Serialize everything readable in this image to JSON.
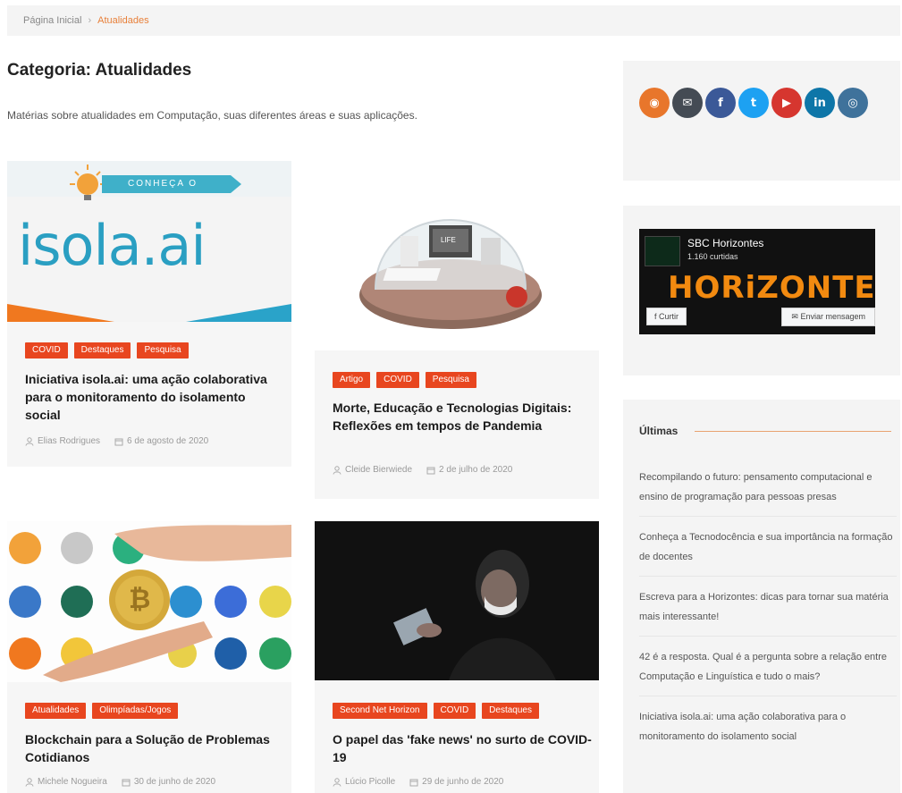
{
  "breadcrumb": {
    "home": "Página Inicial",
    "separator": "›",
    "current": "Atualidades"
  },
  "page": {
    "title": "Categoria: Atualidades",
    "description": "Matérias sobre atualidades em Computação, suas diferentes áreas e suas aplicações."
  },
  "posts": [
    {
      "tags": [
        "COVID",
        "Destaques",
        "Pesquisa"
      ],
      "title": "Iniciativa isola.ai: uma ação colaborativa para o monitoramento do isolamento social",
      "author": "Elias Rodrigues",
      "date": "6 de agosto de 2020",
      "thumb": {
        "banner": "CONHEÇA O",
        "logo": "isola.ai"
      }
    },
    {
      "tags": [
        "Artigo",
        "COVID",
        "Pesquisa"
      ],
      "title": "Morte, Educação e Tecnologias Digitais: Reflexões em tempos de Pandemia",
      "author": "Cleide Bierwiede",
      "date": "2 de julho de 2020",
      "thumb": {
        "screen": "LIFE"
      }
    },
    {
      "tags": [
        "Atualidades",
        "Olimpíadas/Jogos"
      ],
      "title": "Blockchain para a Solução de Problemas Cotidianos",
      "author": "Michele Nogueira",
      "date": "30 de junho de 2020"
    },
    {
      "tags": [
        "Second Net Horizon",
        "COVID",
        "Destaques"
      ],
      "title": "O papel das 'fake news' no surto de COVID-19",
      "author": "Lúcio Picolle",
      "date": "29 de junho de 2020"
    }
  ],
  "social": [
    {
      "name": "rss",
      "glyph": "◉",
      "color": "#e8762b"
    },
    {
      "name": "email",
      "glyph": "✉",
      "color": "#444b54"
    },
    {
      "name": "facebook",
      "glyph": "f",
      "color": "#3b5998"
    },
    {
      "name": "twitter",
      "glyph": "t",
      "color": "#1da1f2"
    },
    {
      "name": "youtube",
      "glyph": "▶",
      "color": "#d6362f"
    },
    {
      "name": "linkedin",
      "glyph": "in",
      "color": "#0e76a8"
    },
    {
      "name": "instagram",
      "glyph": "◎",
      "color": "#3f729b"
    }
  ],
  "facebook": {
    "name": "SBC Horizontes",
    "likes": "1.160 curtidas",
    "banner": "HORiZONTE",
    "like_button": "Curtir",
    "share_button": "Enviar mensagem"
  },
  "latest": {
    "title": "Últimas",
    "items": [
      "Recompilando o futuro: pensamento computacional e ensino de programação para pessoas presas",
      "Conheça a Tecnodocência e sua importância na formação de docentes",
      "Escreva para a Horizontes: dicas para tornar sua matéria mais interessante!",
      "42 é a resposta. Qual é a pergunta sobre a relação entre Computação e Linguística e tudo o mais?",
      "Iniciativa isola.ai: uma ação colaborativa para o monitoramento do isolamento social"
    ]
  }
}
